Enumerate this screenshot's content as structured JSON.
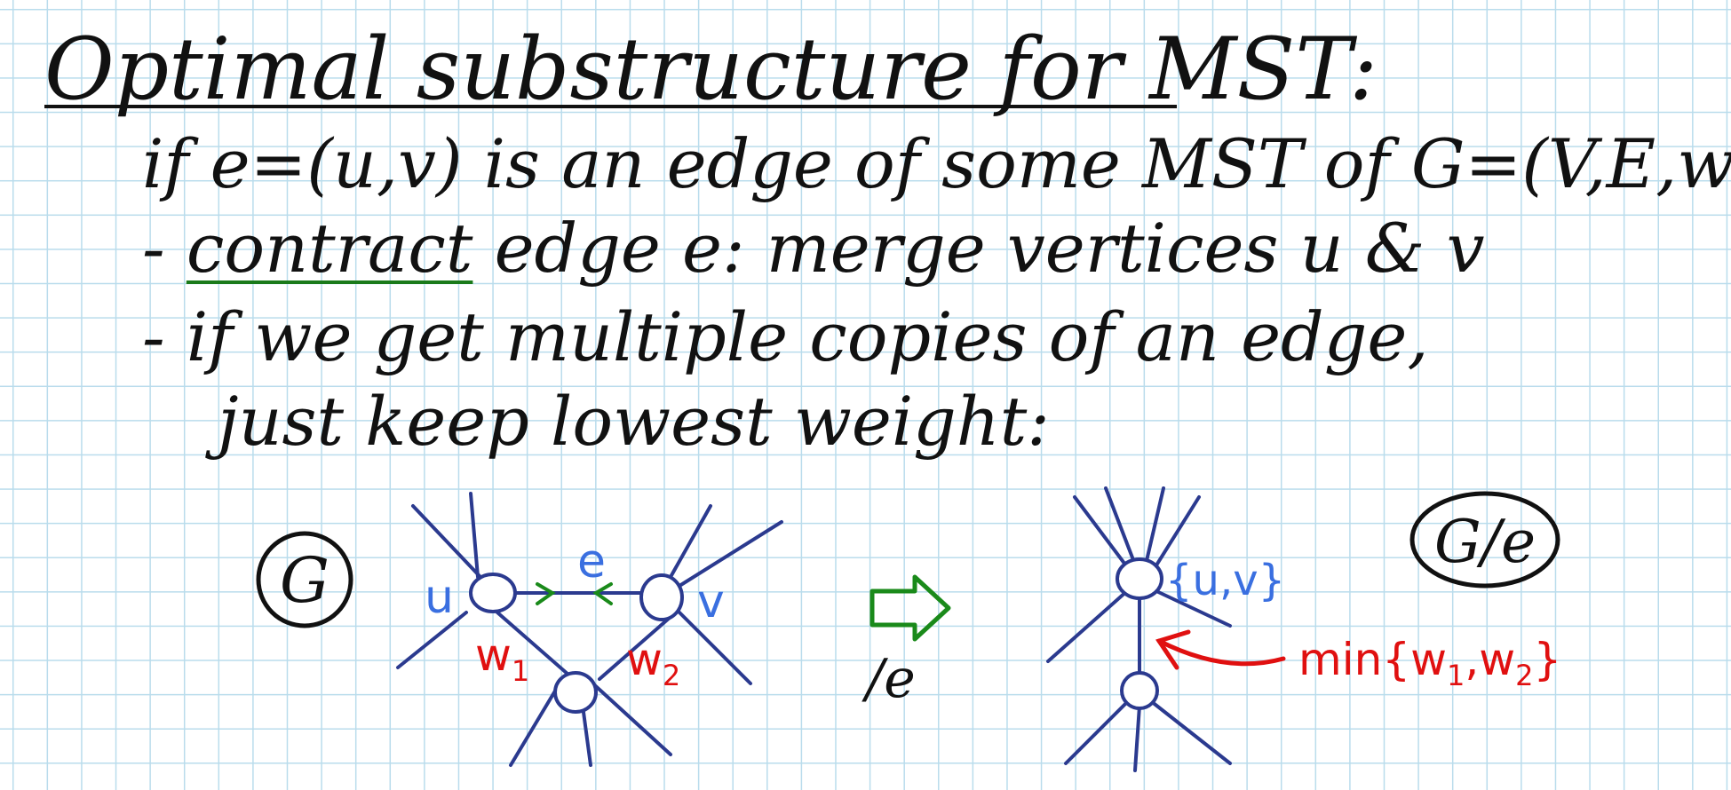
{
  "title": "Optimal substructure for MST:",
  "lines": {
    "l1": "if e=(u,v) is an edge of some MST of G=(V,E,w):",
    "l2_dash": "- ",
    "l2_keyword": "contract",
    "l2_rest": " edge e: merge vertices u & v",
    "l3": "- if we get multiple copies of an edge,",
    "l4": "just keep lowest weight:"
  },
  "diagram": {
    "left_graph_label": "G",
    "u": "u",
    "v": "v",
    "e": "e",
    "w1": "w",
    "w1_sub": "1",
    "w2": "w",
    "w2_sub": "2",
    "contract_label": "/e",
    "merged_node": "{u,v}",
    "right_graph_label": "G/e",
    "min_label": "min{w",
    "min_sub1": "1",
    "min_mid": ",w",
    "min_sub2": "2",
    "min_end": "}"
  },
  "colors": {
    "ink": "#111111",
    "graph": "#2b3a8f",
    "blue_label": "#3a6fe0",
    "green": "#1a8a1a",
    "red": "#e01010",
    "grid": "#b9dcec"
  }
}
